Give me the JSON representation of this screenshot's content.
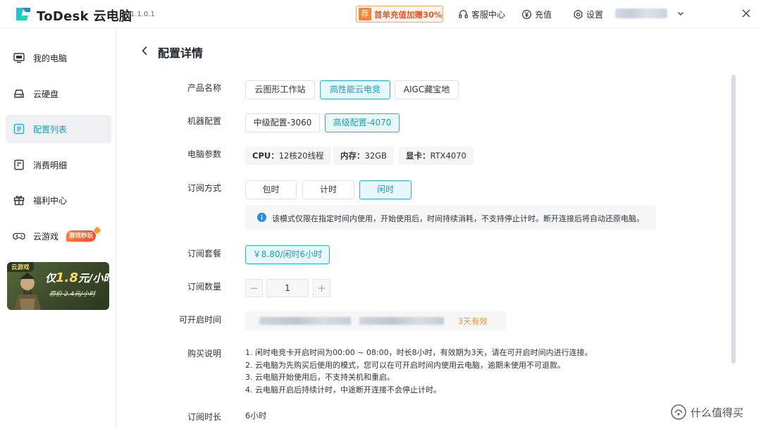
{
  "titlebar": {
    "app_name": "ToDesk 云电脑",
    "version": "V1.1.0.1",
    "promo_badge": "荐",
    "promo_text": "首单充值加赠30%",
    "support": "客服中心",
    "recharge": "充值",
    "settings": "设置"
  },
  "sidebar": {
    "items": [
      {
        "label": "我的电脑",
        "icon": "monitor-icon"
      },
      {
        "label": "云硬盘",
        "icon": "drive-icon"
      },
      {
        "label": "配置列表",
        "icon": "config-list-icon",
        "active": true
      },
      {
        "label": "消费明细",
        "icon": "receipt-icon"
      },
      {
        "label": "福利中心",
        "icon": "gift-icon"
      },
      {
        "label": "云游戏",
        "icon": "gamepad-icon"
      }
    ],
    "hot_tag": "游戏秒玩",
    "banner": {
      "tag": "云游戏",
      "main_prefix": "仅",
      "price": "1.8",
      "main_suffix": "元/小时",
      "original": "原价 2.4元/小时"
    }
  },
  "main": {
    "title": "配置详情",
    "labels": {
      "product": "产品名称",
      "machine": "机器配置",
      "params": "电脑参数",
      "subscription": "订阅方式",
      "package": "订阅套餐",
      "quantity": "订阅数量",
      "start_time": "可开启时间",
      "notes": "购买说明",
      "duration": "订阅时长"
    },
    "products": [
      "云图形工作站",
      "高性能云电竞",
      "AIGC藏宝地"
    ],
    "machines": [
      "中级配置-3060",
      "高级配置-4070"
    ],
    "specs": {
      "cpu_label": "CPU：",
      "cpu_value": "12核20线程",
      "mem_label": "内存：",
      "mem_value": "32GB",
      "gpu_label": "显卡：",
      "gpu_value": "RTX4070"
    },
    "subscriptions": [
      "包时",
      "计时",
      "闲时"
    ],
    "info": "该模式仅限在指定时间内使用，开始使用后，时间持续消耗，不支持停止计时。断开连接后将自动还原电脑。",
    "package": "￥8.80/闲时6小时",
    "quantity": "1",
    "stepper_minus": "−",
    "stepper_plus": "+",
    "validity": "3天有效",
    "notes": [
      "1. 闲时电竞卡开启时间为00:00 ~ 08:00，时长8小时，有效期为3天，请在可开启时间内进行连接。",
      "2. 云电脑为先购买后使用的模式，您可以在可开启时间内使用云电脑，逾期未使用不可退款。",
      "3. 云电脑开始使用后，不支持关机和重启。",
      "4. 云电脑开启后持续计时，中途断开连接不会停止计时。"
    ],
    "duration": "6小时"
  },
  "watermark": "什么值得买",
  "colors": {
    "accent": "#2bb3c8",
    "selected_bg": "#e8f7fa",
    "promo": "#e8572a",
    "validity": "#f0933a"
  }
}
